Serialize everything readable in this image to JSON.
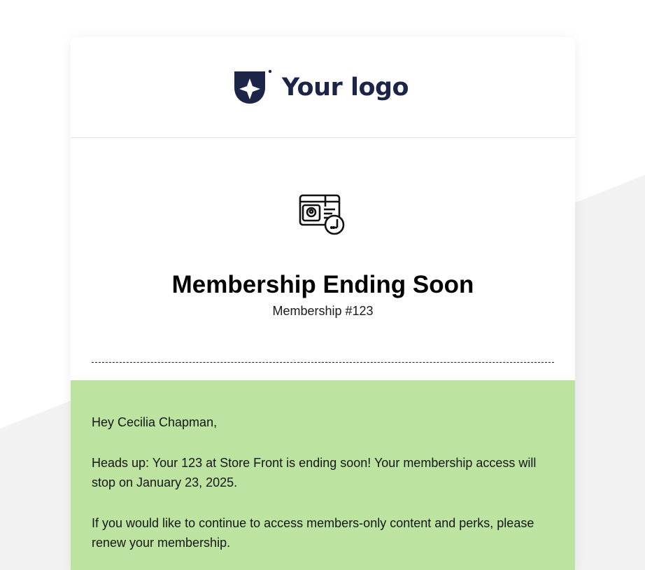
{
  "brand": {
    "logo_text": "Your logo",
    "logo_icon": "shield-star-icon",
    "logo_color": "#1c2448"
  },
  "hero": {
    "icon": "membership-card-clock-icon",
    "title": "Membership Ending Soon",
    "subtitle": "Membership #123"
  },
  "message": {
    "greeting": "Hey Cecilia Chapman,",
    "paragraph1": "Heads up: Your 123 at Store Front is ending soon! Your membership access will stop on January 23, 2025.",
    "paragraph2": "If you would like to continue to access members-only content and perks, please renew your membership.",
    "background_color": "#bce4a0"
  }
}
